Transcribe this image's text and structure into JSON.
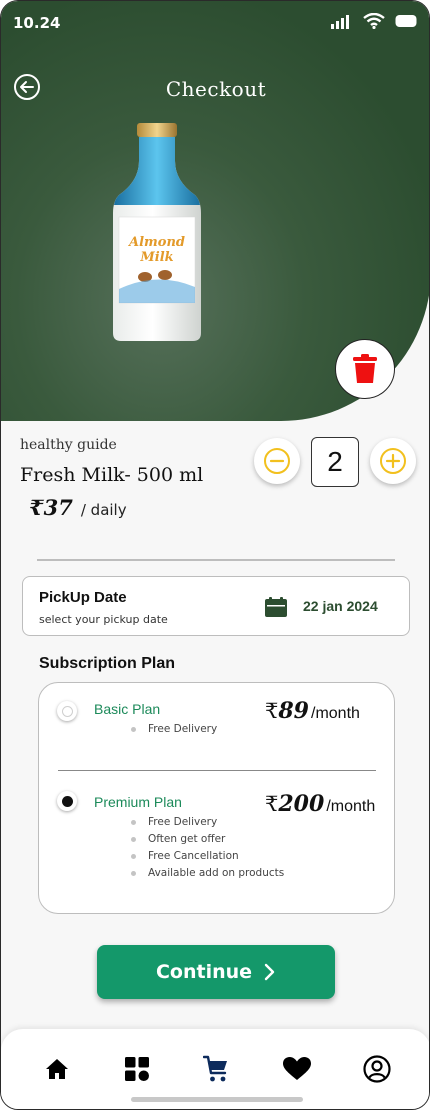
{
  "status_bar": {
    "time": "10.24",
    "icons": [
      "signal-icon",
      "wifi-icon",
      "battery-icon"
    ]
  },
  "header": {
    "title": "Checkout",
    "back_icon": "back-arrow-icon"
  },
  "product": {
    "image": "almond-milk-bottle",
    "bottle_label_line1": "Almond",
    "bottle_label_line2": "Milk",
    "subtitle": "healthy guide",
    "name": "Fresh Milk- 500 ml",
    "currency": "₹",
    "price": "37",
    "price_unit": "/ daily",
    "delete_icon": "trash-icon"
  },
  "quantity": {
    "value": "2",
    "decrement_icon": "minus-circle-icon",
    "increment_icon": "plus-circle-icon"
  },
  "pickup": {
    "title": "PickUp Date",
    "hint": "select your  pickup date",
    "date": "22 jan 2024",
    "icon": "calendar-icon"
  },
  "subscription": {
    "heading": "Subscription Plan",
    "plans": [
      {
        "name": "Basic Plan",
        "currency": "₹",
        "price": "89",
        "period": "/month",
        "selected": false,
        "features": [
          "Free Delivery"
        ]
      },
      {
        "name": "Premium Plan",
        "currency": "₹",
        "price": "200",
        "period": "/month",
        "selected": true,
        "features": [
          "Free Delivery",
          "Often get offer",
          "Free Cancellation",
          "Available add on products"
        ]
      }
    ]
  },
  "actions": {
    "continue_label": "Continue",
    "continue_icon": "chevron-right-icon"
  },
  "tab_bar": {
    "items": [
      {
        "icon": "home-icon",
        "active": false
      },
      {
        "icon": "grid-icon",
        "active": false
      },
      {
        "icon": "cart-icon",
        "active": true
      },
      {
        "icon": "heart-icon",
        "active": false
      },
      {
        "icon": "profile-icon",
        "active": false
      }
    ]
  },
  "colors": {
    "brand_green": "#2c4d30",
    "accent_green": "#14986a",
    "plan_text": "#1c8a5a",
    "qty_yellow": "#f2c01e",
    "delete_red": "#ee1111",
    "cart_blue": "#0d2b5c"
  }
}
